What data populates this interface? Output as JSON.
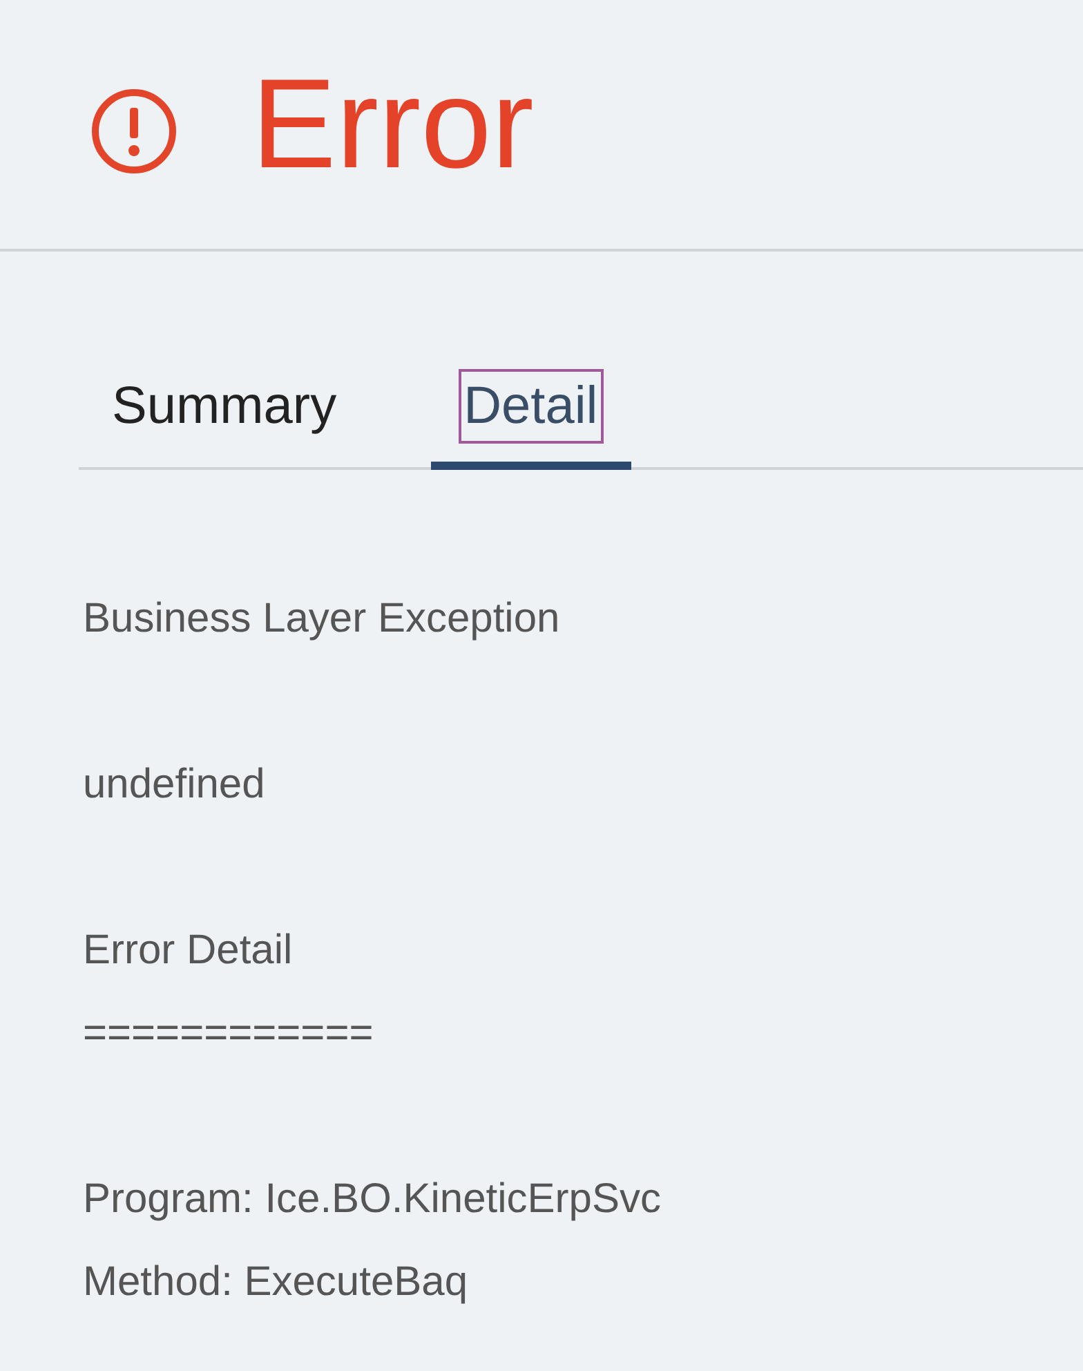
{
  "header": {
    "title": "Error"
  },
  "tabs": [
    {
      "label": "Summary",
      "selected": false,
      "focused": false
    },
    {
      "label": "Detail",
      "selected": true,
      "focused": true
    }
  ],
  "detail": {
    "paragraphs": [
      [
        "Business Layer Exception"
      ],
      [
        "undefined"
      ],
      [
        "Error Detail",
        "============"
      ],
      [
        "Program: Ice.BO.KineticErpSvc",
        "Method: ExecuteBaq"
      ]
    ]
  }
}
